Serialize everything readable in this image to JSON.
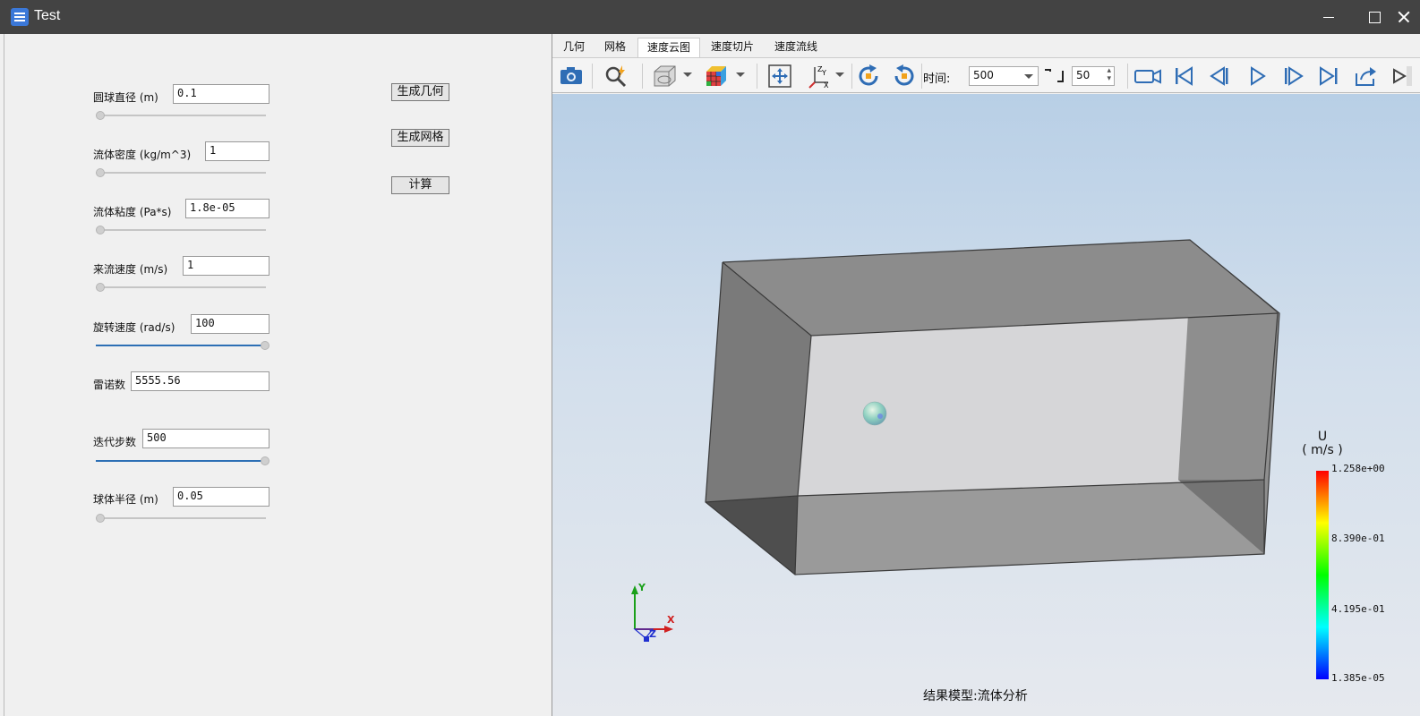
{
  "window": {
    "title": "Test"
  },
  "params": [
    {
      "label": "圆球直径 (m)",
      "value": "0.1",
      "slider": 0
    },
    {
      "label": "流体密度 (kg/m^3)",
      "value": "1",
      "slider": 0
    },
    {
      "label": "流体粘度 (Pa*s)",
      "value": "1.8e-05",
      "slider": 0
    },
    {
      "label": "来流速度 (m/s)",
      "value": "1",
      "slider": 0
    },
    {
      "label": "旋转速度 (rad/s)",
      "value": "100",
      "slider": 1
    },
    {
      "label": "雷诺数",
      "value": "5555.56"
    },
    {
      "label": "迭代步数",
      "value": "500",
      "slider": 1
    },
    {
      "label": "球体半径 (m)",
      "value": "0.05",
      "slider": 0
    }
  ],
  "actions": {
    "generate_geometry": "生成几何",
    "generate_mesh": "生成网格",
    "compute": "计算"
  },
  "tabs": [
    {
      "label": "几何",
      "active": false
    },
    {
      "label": "网格",
      "active": false
    },
    {
      "label": "速度云图",
      "active": true
    },
    {
      "label": "速度切片",
      "active": false
    },
    {
      "label": "速度流线",
      "active": false
    }
  ],
  "toolbar": {
    "time_label": "时间:",
    "time_value": "500",
    "step_value": "50",
    "icons": [
      "camera-icon",
      "zoom-icon",
      "display-mode-icon",
      "color-cube-icon",
      "fit-view-icon",
      "axis-orient-icon",
      "rotate-cw-icon",
      "rotate-ccw-icon",
      "record-icon",
      "first-frame-icon",
      "prev-frame-icon",
      "play-icon",
      "next-frame-icon",
      "last-frame-icon",
      "export-icon"
    ]
  },
  "legend": {
    "title": "U",
    "unit": "( m/s )",
    "ticks": [
      "1.258e+00",
      "8.390e-01",
      "4.195e-01",
      "1.385e-05"
    ],
    "colors": [
      "#ff0000",
      "#ffff00",
      "#00ff00",
      "#00ffff",
      "#0000ff"
    ]
  },
  "axes": {
    "x": "X",
    "y": "Y",
    "z": "Z"
  },
  "footer": "结果模型:流体分析",
  "colors": {
    "titlebar": "#434343",
    "box_face": "#8c8c8c",
    "accent": "#2c6fb5"
  }
}
